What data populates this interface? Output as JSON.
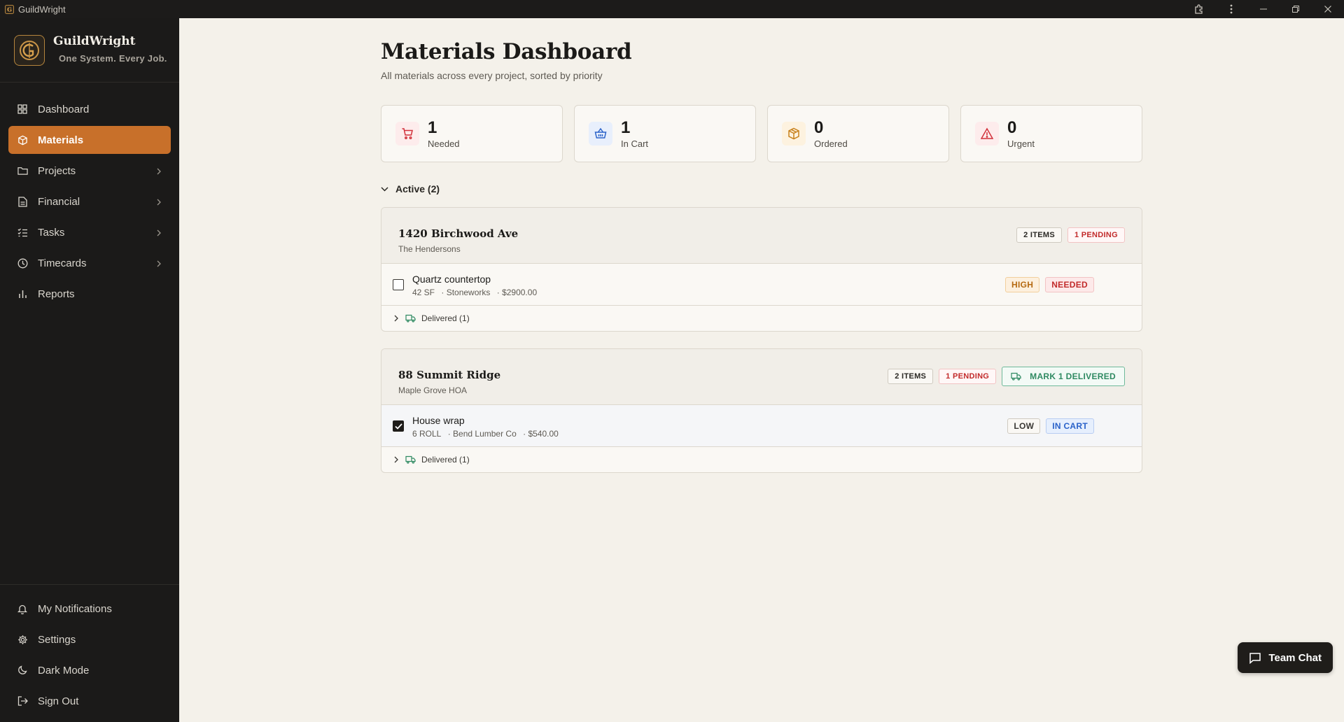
{
  "window": {
    "title": "GuildWright"
  },
  "brand": {
    "name": "GuildWright",
    "tagline": "One System. Every Job."
  },
  "nav": [
    {
      "label": "Dashboard",
      "icon": "dashboard-icon"
    },
    {
      "label": "Materials",
      "icon": "package-icon",
      "active": true
    },
    {
      "label": "Projects",
      "icon": "folder-icon",
      "has_children": true
    },
    {
      "label": "Financial",
      "icon": "document-icon",
      "has_children": true
    },
    {
      "label": "Tasks",
      "icon": "list-icon",
      "has_children": true
    },
    {
      "label": "Timecards",
      "icon": "clock-icon",
      "has_children": true
    },
    {
      "label": "Reports",
      "icon": "bar-chart-icon"
    }
  ],
  "bottom_nav": [
    {
      "label": "My Notifications",
      "icon": "bell-icon"
    },
    {
      "label": "Settings",
      "icon": "gear-icon"
    },
    {
      "label": "Dark Mode",
      "icon": "moon-icon"
    },
    {
      "label": "Sign Out",
      "icon": "sign-out-icon"
    }
  ],
  "page": {
    "title": "Materials Dashboard",
    "subtitle": "All materials across every project, sorted by priority"
  },
  "stats": [
    {
      "value": "1",
      "label": "Needed",
      "icon": "cart-icon",
      "color": "#d2303a",
      "bg": "#fdecec"
    },
    {
      "value": "1",
      "label": "In Cart",
      "icon": "basket-icon",
      "color": "#2a62c9",
      "bg": "#e8effc"
    },
    {
      "value": "0",
      "label": "Ordered",
      "icon": "box-icon",
      "color": "#c8811c",
      "bg": "#fdf2df"
    },
    {
      "value": "0",
      "label": "Urgent",
      "icon": "alert-icon",
      "color": "#d2303a",
      "bg": "#fdecec"
    }
  ],
  "section": {
    "label": "Active (2)"
  },
  "projects": [
    {
      "name": "1420 Birchwood Ave",
      "client": "The Hendersons",
      "items_badge": "2 ITEMS",
      "pending_badge": "1 PENDING",
      "action": "",
      "item": {
        "name": "Quartz countertop",
        "qty": "42 SF",
        "vendor": "· Stoneworks",
        "price": "· $2900.00",
        "priority": "HIGH",
        "status": "NEEDED",
        "checked": false
      },
      "delivered": "Delivered (1)"
    },
    {
      "name": "88 Summit Ridge",
      "client": "Maple Grove HOA",
      "items_badge": "2 ITEMS",
      "pending_badge": "1 PENDING",
      "action": "MARK 1 DELIVERED",
      "item": {
        "name": "House wrap",
        "qty": "6 ROLL",
        "vendor": "· Bend Lumber Co",
        "price": "· $540.00",
        "priority": "LOW",
        "status": "IN CART",
        "checked": true
      },
      "delivered": "Delivered (1)"
    }
  ],
  "team_chat": {
    "label": "Team Chat"
  },
  "colors": {
    "accent": "#c8702a",
    "sidebar_bg": "#1b1a19",
    "page_bg": "#f4f1ea"
  }
}
